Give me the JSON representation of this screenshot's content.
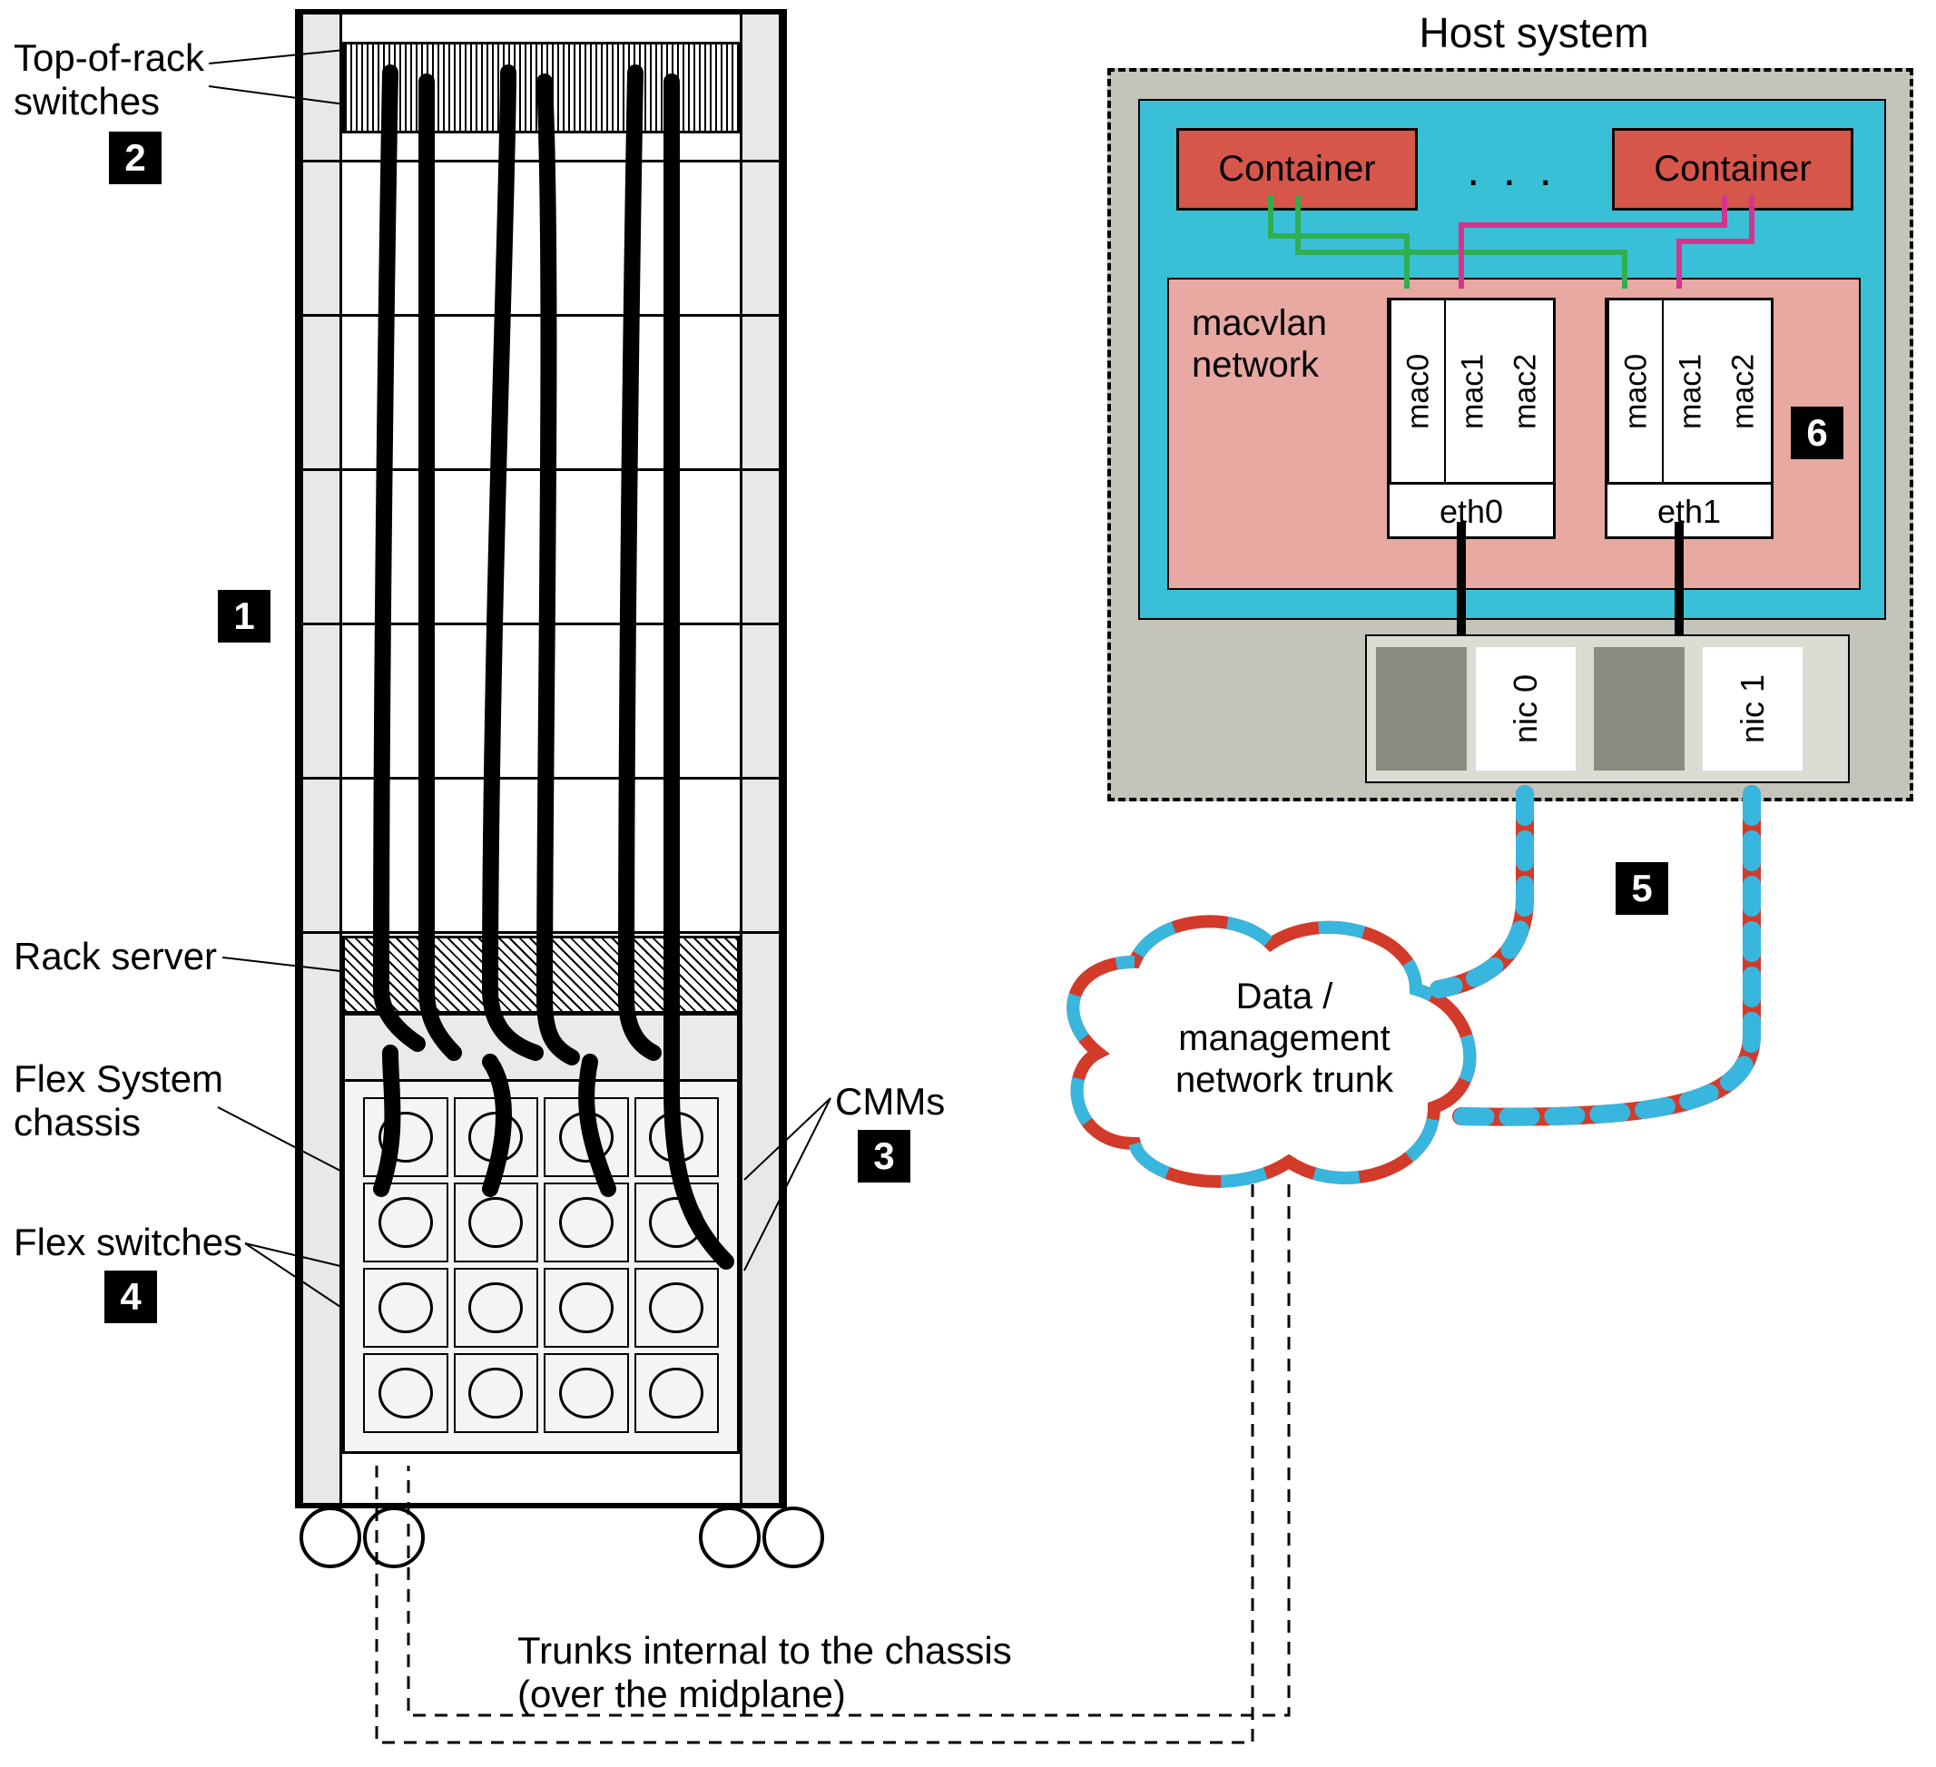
{
  "rack": {
    "tor_label": "Top-of-rack\nswitches",
    "rack_server_label": "Rack server",
    "flex_chassis_label": "Flex System\nchassis",
    "flex_switches_label": "Flex switches",
    "cmms_label": "CMMs",
    "trunks_label": "Trunks internal to the chassis\n(over the midplane)"
  },
  "host": {
    "title": "Host system",
    "container_label": "Container",
    "dots": ". . .",
    "macvlan_label": "macvlan\nnetwork",
    "eth0": {
      "name": "eth0",
      "macs": [
        "mac0",
        "mac1",
        "mac2"
      ]
    },
    "eth1": {
      "name": "eth1",
      "macs": [
        "mac0",
        "mac1",
        "mac2"
      ]
    },
    "nic0": "nic 0",
    "nic1": "nic 1"
  },
  "cloud": {
    "text": "Data /\nmanagement\nnetwork trunk"
  },
  "badges": {
    "b1": "1",
    "b2": "2",
    "b3": "3",
    "b4": "4",
    "b5": "5",
    "b6": "6"
  },
  "colors": {
    "cyan": "#39c0d6",
    "salmon": "#e7a9a2",
    "containerRed": "#d6574a",
    "cloudRed": "#d23b2a",
    "cloudBlue": "#39b6de",
    "greenWire": "#2fae52",
    "magentaWire": "#d6348c"
  }
}
